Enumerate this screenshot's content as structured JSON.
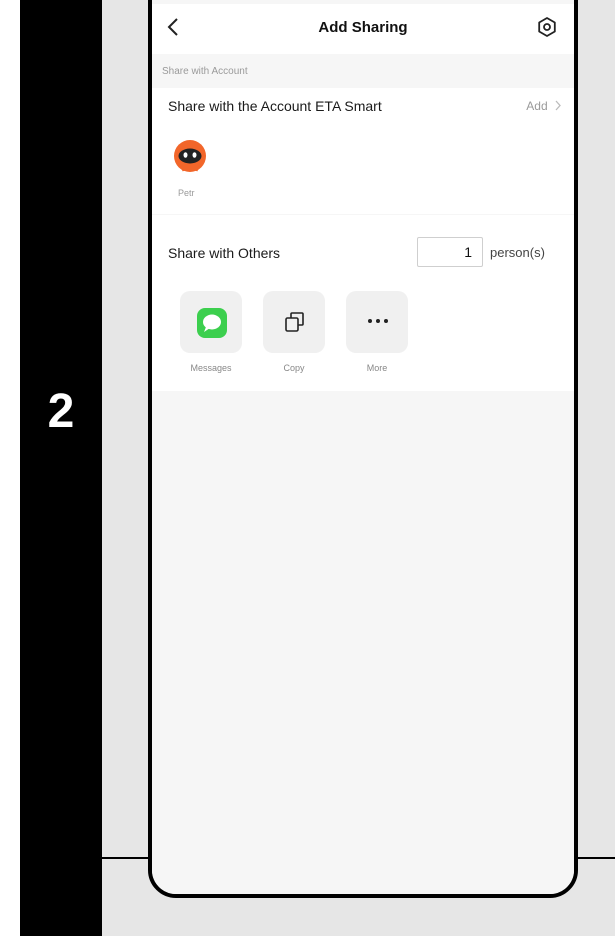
{
  "step": {
    "number": "2"
  },
  "nav": {
    "title": "Add Sharing",
    "back_icon": "chevron-left-icon",
    "settings_icon": "settings-icon"
  },
  "account_section": {
    "label": "Share with Account",
    "title": "Share with the Account ETA Smart",
    "add_label": "Add",
    "user": {
      "name": "Petr",
      "avatar_icon": "robot-avatar-icon",
      "avatar_color": "#f2662a"
    }
  },
  "others_section": {
    "title": "Share with Others",
    "count": "1",
    "unit": "person(s)",
    "options": [
      {
        "label": "Messages",
        "icon": "messages-icon",
        "color": "#3ccf4e"
      },
      {
        "label": "Copy",
        "icon": "copy-icon"
      },
      {
        "label": "More",
        "icon": "more-icon"
      }
    ]
  },
  "colors": {
    "left_bar": "#000000",
    "panel": "#e6e6e6",
    "screen_bg": "#f6f6f6"
  }
}
